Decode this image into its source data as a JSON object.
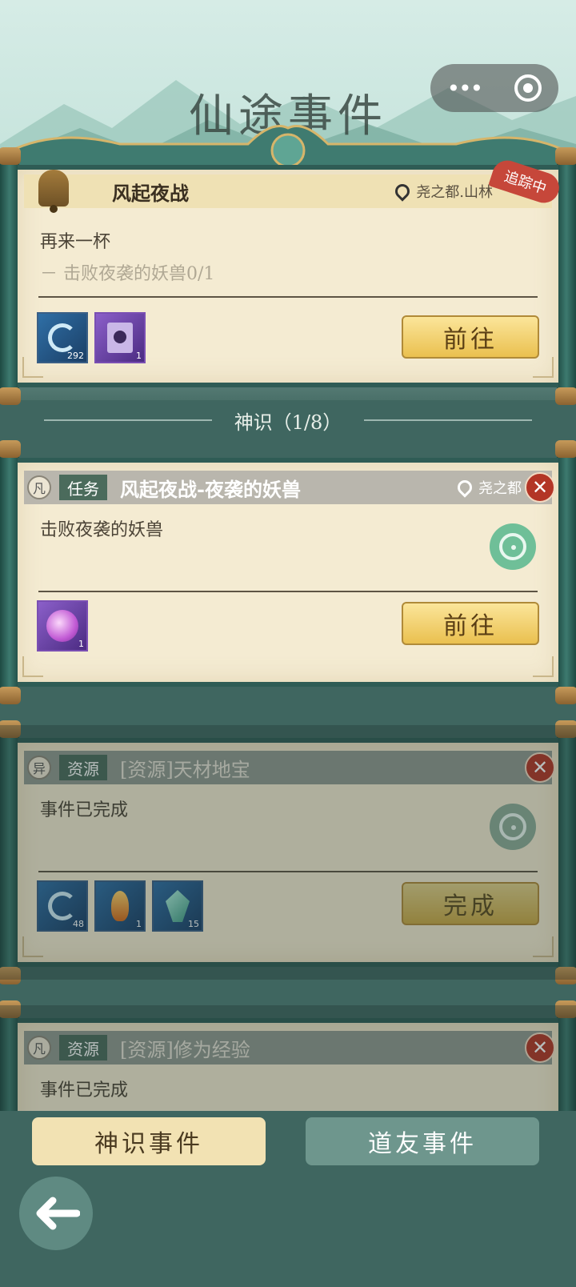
{
  "header": {
    "title": "仙途事件"
  },
  "capsule": {
    "more_label": "•••"
  },
  "tracked_card": {
    "title": "风起夜战",
    "location": "尧之都.山林",
    "tracking_badge": "追踪中",
    "step": "再来一杯",
    "subtask": "－ 击败夜袭的妖兽0/1",
    "rewards": [
      {
        "icon": "wind-swirl-icon",
        "count": "292"
      },
      {
        "icon": "purple-book-icon",
        "count": "1"
      }
    ],
    "go_label": "前往"
  },
  "section": {
    "label": "神识（1/8）"
  },
  "events": [
    {
      "rank": "凡",
      "tag": "任务",
      "title": "风起夜战-夜袭的妖兽",
      "location": "尧之都",
      "desc": "击败夜袭的妖兽",
      "rewards": [
        {
          "icon": "purple-orb-icon",
          "count": "1"
        }
      ],
      "action_label": "前往"
    },
    {
      "rank": "异",
      "tag": "资源",
      "title": "[资源]天材地宝",
      "desc": "事件已完成",
      "rewards": [
        {
          "icon": "wind-swirl-icon",
          "count": "48"
        },
        {
          "icon": "flame-icon",
          "count": "1"
        },
        {
          "icon": "crystal-icon",
          "count": "15"
        }
      ],
      "action_label": "完成"
    },
    {
      "rank": "凡",
      "tag": "资源",
      "title": "[资源]修为经验",
      "desc": "事件已完成"
    }
  ],
  "bottom_tabs": {
    "active": "神识事件",
    "inactive": "道友事件"
  }
}
